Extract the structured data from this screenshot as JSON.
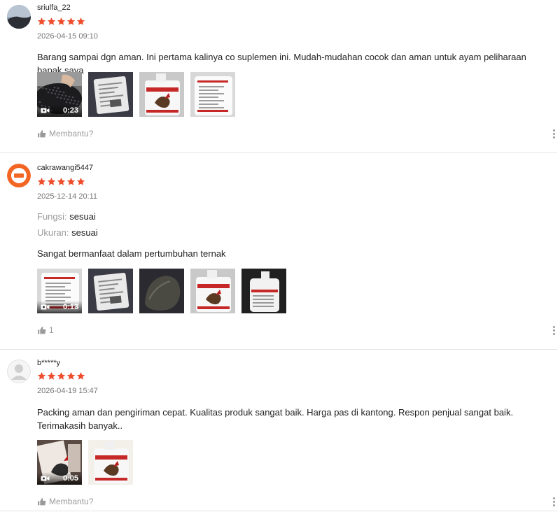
{
  "reviews": [
    {
      "username": "sriulfa_22",
      "rating": 5,
      "date": "2026-04-15 09:10",
      "attributes": [],
      "text": "Barang sampai dgn aman. Ini pertama kalinya co suplemen ini. Mudah-mudahan cocok dan aman untuk ayam peliharaan bapak saya",
      "media": [
        {
          "kind": "video",
          "duration": "0:23",
          "scene": "black-granules"
        },
        {
          "kind": "photo",
          "scene": "label-sticker"
        },
        {
          "kind": "photo",
          "scene": "bottle-front"
        },
        {
          "kind": "photo",
          "scene": "bottle-back"
        }
      ],
      "helpful_label": "Membantu?",
      "helpful_count": ""
    },
    {
      "username": "cakrawangi5447",
      "rating": 5,
      "date": "2025-12-14 20:11",
      "attributes": [
        {
          "key": "Fungsi:",
          "value": "sesuai"
        },
        {
          "key": "Ukuran:",
          "value": "sesuai"
        }
      ],
      "text": "Sangat bermanfaat dalam pertumbuhan ternak",
      "media": [
        {
          "kind": "video",
          "duration": "0:13",
          "scene": "bottle-back"
        },
        {
          "kind": "photo",
          "scene": "label-sticker"
        },
        {
          "kind": "photo",
          "scene": "dark-pouch"
        },
        {
          "kind": "photo",
          "scene": "bottle-front"
        },
        {
          "kind": "photo",
          "scene": "bottle-side"
        }
      ],
      "helpful_label": "",
      "helpful_count": "1"
    },
    {
      "username": "b*****y",
      "rating": 5,
      "date": "2026-04-19 15:47",
      "attributes": [],
      "text": "Packing aman dan pengiriman cepat. Kualitas produk sangat baik. Harga pas di kantong. Respon penjual sangat baik. Terimakasih banyak..",
      "media": [
        {
          "kind": "video",
          "duration": "0:05",
          "scene": "rooster-box"
        },
        {
          "kind": "photo",
          "scene": "rooster-label"
        }
      ],
      "helpful_label": "Membantu?",
      "helpful_count": ""
    }
  ],
  "colors": {
    "star": "#ee4d2d",
    "muted": "#9a9a9a",
    "date": "#757575",
    "divider": "#e4e4e4",
    "avatar_orange": "#f26522"
  },
  "icons": {
    "star": "star-icon",
    "thumb": "thumbs-up-icon",
    "video": "video-camera-icon",
    "more": "more-vertical-icon"
  }
}
